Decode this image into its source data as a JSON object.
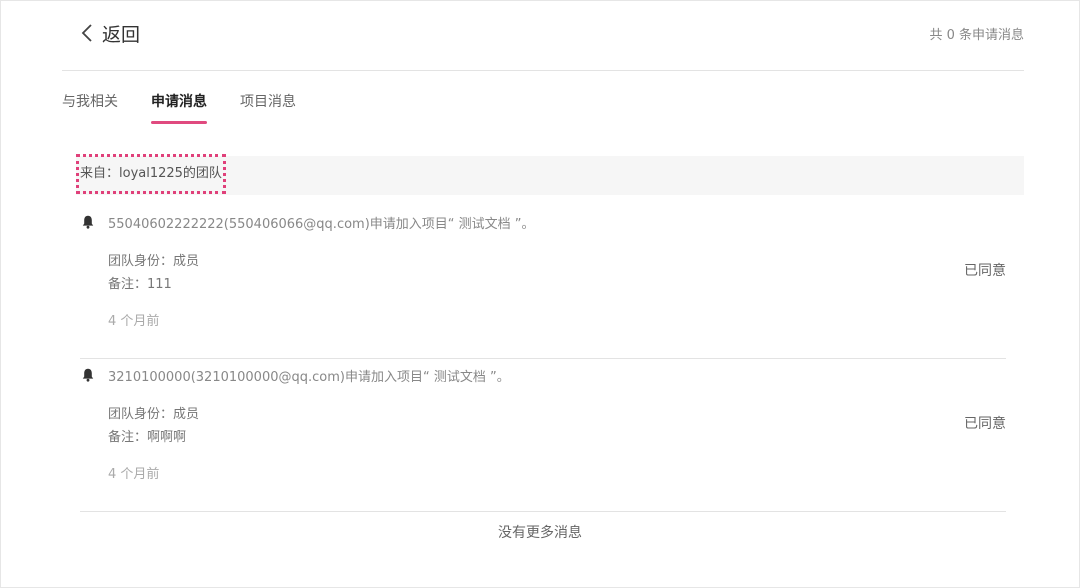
{
  "header": {
    "back_label": "返回",
    "total_text": "共 0 条申请消息"
  },
  "tabs": [
    {
      "label": "与我相关",
      "active": false
    },
    {
      "label": "申请消息",
      "active": true
    },
    {
      "label": "项目消息",
      "active": false
    }
  ],
  "group": {
    "title": "来自：loyal1225的团队"
  },
  "messages": [
    {
      "title": "55040602222222(550406066@qq.com)申请加入项目“ 测试文档 ”。",
      "role": "团队身份：成员",
      "remark": "备注：111",
      "time": "4 个月前",
      "status": "已同意"
    },
    {
      "title": "3210100000(3210100000@qq.com)申请加入项目“ 测试文档 ”。",
      "role": "团队身份：成员",
      "remark": "备注：啊啊啊",
      "time": "4 个月前",
      "status": "已同意"
    }
  ],
  "footer": {
    "no_more": "没有更多消息"
  },
  "colors": {
    "accent": "#e04a7f"
  },
  "icons": {
    "back": "chevron-left-icon",
    "bell": "bell-icon"
  }
}
